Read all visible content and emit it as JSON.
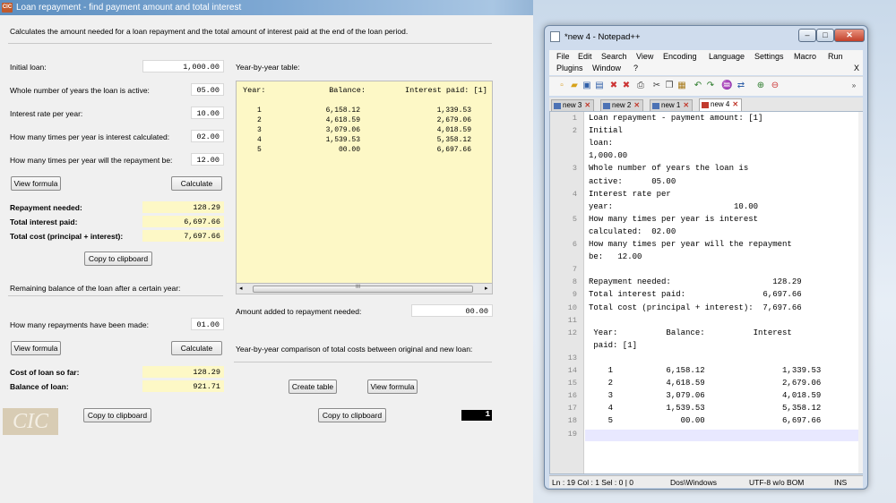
{
  "window": {
    "title": "Loan repayment - find payment amount and total interest",
    "app_icon": "CIC"
  },
  "description": "Calculates the amount needed for a loan repayment and the total amount of interest paid at the end of the loan period.",
  "inputs": {
    "initial_loan_label": "Initial loan:",
    "initial_loan": "1,000.00",
    "years_label": "Whole number of years the loan is active:",
    "years": "05.00",
    "rate_label": "Interest rate per year:",
    "rate": "10.00",
    "calc_times_label": "How many times per year is interest calculated:",
    "calc_times": "02.00",
    "repay_times_label": "How many times per year will the repayment be:",
    "repay_times": "12.00"
  },
  "buttons": {
    "view_formula": "View formula",
    "calculate": "Calculate",
    "copy_clipboard": "Copy to clipboard",
    "view_formula2": "View formula",
    "calculate2": "Calculate",
    "copy_clipboard2": "Copy to clipboard",
    "create_table": "Create table",
    "view_formula3": "View formula",
    "copy_clipboard3": "Copy to clipboard"
  },
  "results": {
    "repayment_label": "Repayment needed:",
    "repayment": "128.29",
    "interest_label": "Total interest paid:",
    "interest": "6,697.66",
    "total_label": "Total cost (principal + interest):",
    "total": "7,697.66"
  },
  "remaining": {
    "heading": "Remaining balance of the loan after a certain year:",
    "made_label": "How many repayments have been made:",
    "made": "01.00",
    "cost_label": "Cost of loan so far:",
    "cost": "128.29",
    "balance_label": "Balance of loan:",
    "balance": "921.71"
  },
  "table": {
    "label": "Year-by-year table:",
    "headers": [
      "Year:",
      "Balance:",
      "Interest paid: [1]"
    ],
    "rows": [
      [
        "1",
        "6,158.12",
        "1,339.53"
      ],
      [
        "2",
        "4,618.59",
        "2,679.06"
      ],
      [
        "3",
        "3,079.06",
        "4,018.59"
      ],
      [
        "4",
        "1,539.53",
        "5,358.12"
      ],
      [
        "5",
        "00.00",
        "6,697.66"
      ]
    ],
    "scroll_grip": "III",
    "added_label": "Amount added to repayment needed:",
    "added": "00.00",
    "compare_label": "Year-by-year comparison of total costs between original and new loan:",
    "counter": "1"
  },
  "notepad": {
    "title": "*new 4 - Notepad++",
    "menu_row1": [
      "File",
      "Edit",
      "Search",
      "View",
      "Encoding",
      "Language",
      "Settings",
      "Macro",
      "Run"
    ],
    "menu_row2": [
      "Plugins",
      "Window",
      "?"
    ],
    "menu_close": "X",
    "tabs": [
      "new 3",
      "new 2",
      "new 1",
      "new 4"
    ],
    "lines": [
      {
        "n": "1",
        "t": "Loan repayment - payment amount: [1]"
      },
      {
        "n": "2",
        "t": "Initial"
      },
      {
        "n": "",
        "t": "loan:"
      },
      {
        "n": "",
        "t": "1,000.00"
      },
      {
        "n": "3",
        "t": "Whole number of years the loan is"
      },
      {
        "n": "",
        "t": "active:      05.00"
      },
      {
        "n": "4",
        "t": "Interest rate per"
      },
      {
        "n": "",
        "t": "year:                         10.00"
      },
      {
        "n": "5",
        "t": "How many times per year is interest"
      },
      {
        "n": "",
        "t": "calculated:  02.00"
      },
      {
        "n": "6",
        "t": "How many times per year will the repayment"
      },
      {
        "n": "",
        "t": "be:   12.00"
      },
      {
        "n": "7",
        "t": ""
      },
      {
        "n": "8",
        "t": "Repayment needed:                     128.29"
      },
      {
        "n": "9",
        "t": "Total interest paid:                6,697.66"
      },
      {
        "n": "10",
        "t": "Total cost (principal + interest):  7,697.66"
      },
      {
        "n": "11",
        "t": ""
      },
      {
        "n": "12",
        "t": " Year:          Balance:          Interest"
      },
      {
        "n": "",
        "t": " paid: [1]"
      },
      {
        "n": "13",
        "t": ""
      },
      {
        "n": "14",
        "t": "    1           6,158.12                1,339.53"
      },
      {
        "n": "15",
        "t": "    2           4,618.59                2,679.06"
      },
      {
        "n": "16",
        "t": "    3           3,079.06                4,018.59"
      },
      {
        "n": "17",
        "t": "    4           1,539.53                5,358.12"
      },
      {
        "n": "18",
        "t": "    5              00.00                6,697.66"
      },
      {
        "n": "19",
        "t": ""
      }
    ],
    "status": {
      "pos": "Ln : 19   Col : 1   Sel : 0 | 0",
      "eol": "Dos\\Windows",
      "enc": "UTF-8 w/o BOM",
      "mode": "INS"
    }
  }
}
